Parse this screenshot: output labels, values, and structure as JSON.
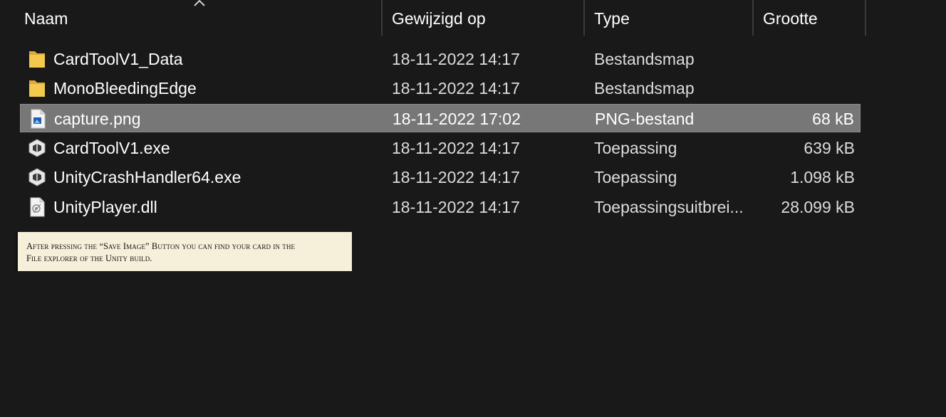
{
  "columns": {
    "name": "Naam",
    "modified": "Gewijzigd op",
    "type": "Type",
    "size": "Grootte"
  },
  "sort": {
    "column": "name",
    "direction": "ascending"
  },
  "files": [
    {
      "icon": "folder-icon",
      "name": "CardToolV1_Data",
      "modified": "18-11-2022 14:17",
      "type": "Bestandsmap",
      "size": ""
    },
    {
      "icon": "folder-icon",
      "name": "MonoBleedingEdge",
      "modified": "18-11-2022 14:17",
      "type": "Bestandsmap",
      "size": ""
    },
    {
      "icon": "png-file-icon",
      "name": "capture.png",
      "modified": "18-11-2022 17:02",
      "type": "PNG-bestand",
      "size": "68 kB",
      "selected": true
    },
    {
      "icon": "unity-exe-icon",
      "name": "CardToolV1.exe",
      "modified": "18-11-2022 14:17",
      "type": "Toepassing",
      "size": "639 kB"
    },
    {
      "icon": "unity-exe-icon",
      "name": "UnityCrashHandler64.exe",
      "modified": "18-11-2022 14:17",
      "type": "Toepassing",
      "size": "1.098 kB"
    },
    {
      "icon": "dll-file-icon",
      "name": "UnityPlayer.dll",
      "modified": "18-11-2022 14:17",
      "type": "Toepassingsuitbrei...",
      "size": "28.099 kB"
    }
  ],
  "caption": {
    "line1": "After pressing the “Save Image” Button you can find your card in the",
    "line2": "File explorer of the Unity build."
  },
  "colors": {
    "background": "#191919",
    "selected_row": "#777777",
    "folder": "#f3c94e",
    "caption_bg": "#f6efda"
  }
}
